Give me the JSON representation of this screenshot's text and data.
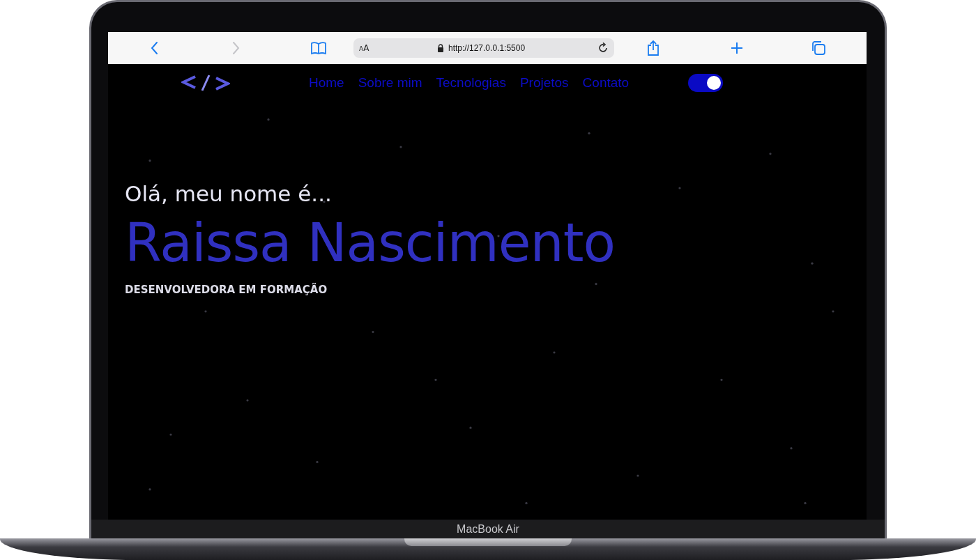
{
  "browser": {
    "text_size_button": "AA",
    "url": "http://127.0.0.1:5500"
  },
  "nav": {
    "links": [
      {
        "label": "Home"
      },
      {
        "label": "Sobre mim"
      },
      {
        "label": "Tecnologias"
      },
      {
        "label": "Projetos"
      },
      {
        "label": "Contato"
      }
    ],
    "theme_toggle": {
      "on": true
    }
  },
  "hero": {
    "greeting": "Olá, meu nome é...",
    "name": "Raissa Nascimento",
    "role": "DESENVOLVEDORA EM FORMAÇÃO"
  },
  "device_label": "MacBook Air"
}
